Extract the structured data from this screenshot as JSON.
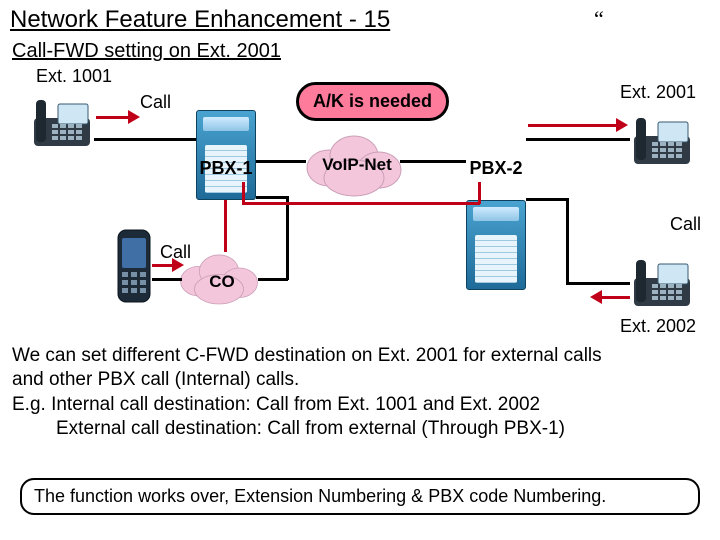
{
  "title": "Network Feature Enhancement - 15",
  "quote": "“",
  "subtitle": "Call-FWD setting on Ext. 2001",
  "labels": {
    "ext1001": "Ext. 1001",
    "ext2001": "Ext. 2001",
    "ext2002": "Ext. 2002",
    "call_a": "Call",
    "call_b": "Call",
    "call_c": "Call",
    "pbx1": "PBX-1",
    "pbx2": "PBX-2",
    "voip": "VoIP-Net",
    "co": "CO",
    "ak": "A/K is needed"
  },
  "paragraph": {
    "l1": "We can set different C-FWD destination on Ext. 2001 for external calls",
    "l2": "and other PBX call (Internal) calls.",
    "l3": "E.g. Internal call destination:  Call from Ext. 1001 and Ext. 2002",
    "l4_pre": "       External call destination: Call from external (Through PBX-1)",
    "l4": "External call destination: Call from external (Through PBX-1)"
  },
  "note": "The function works over, Extension Numbering & PBX code Numbering.",
  "icons": {
    "phone": "desk-phone-icon",
    "pbx": "pbx-rack-icon",
    "cloud": "network-cloud-icon",
    "mobile": "mobile-phone-icon"
  }
}
